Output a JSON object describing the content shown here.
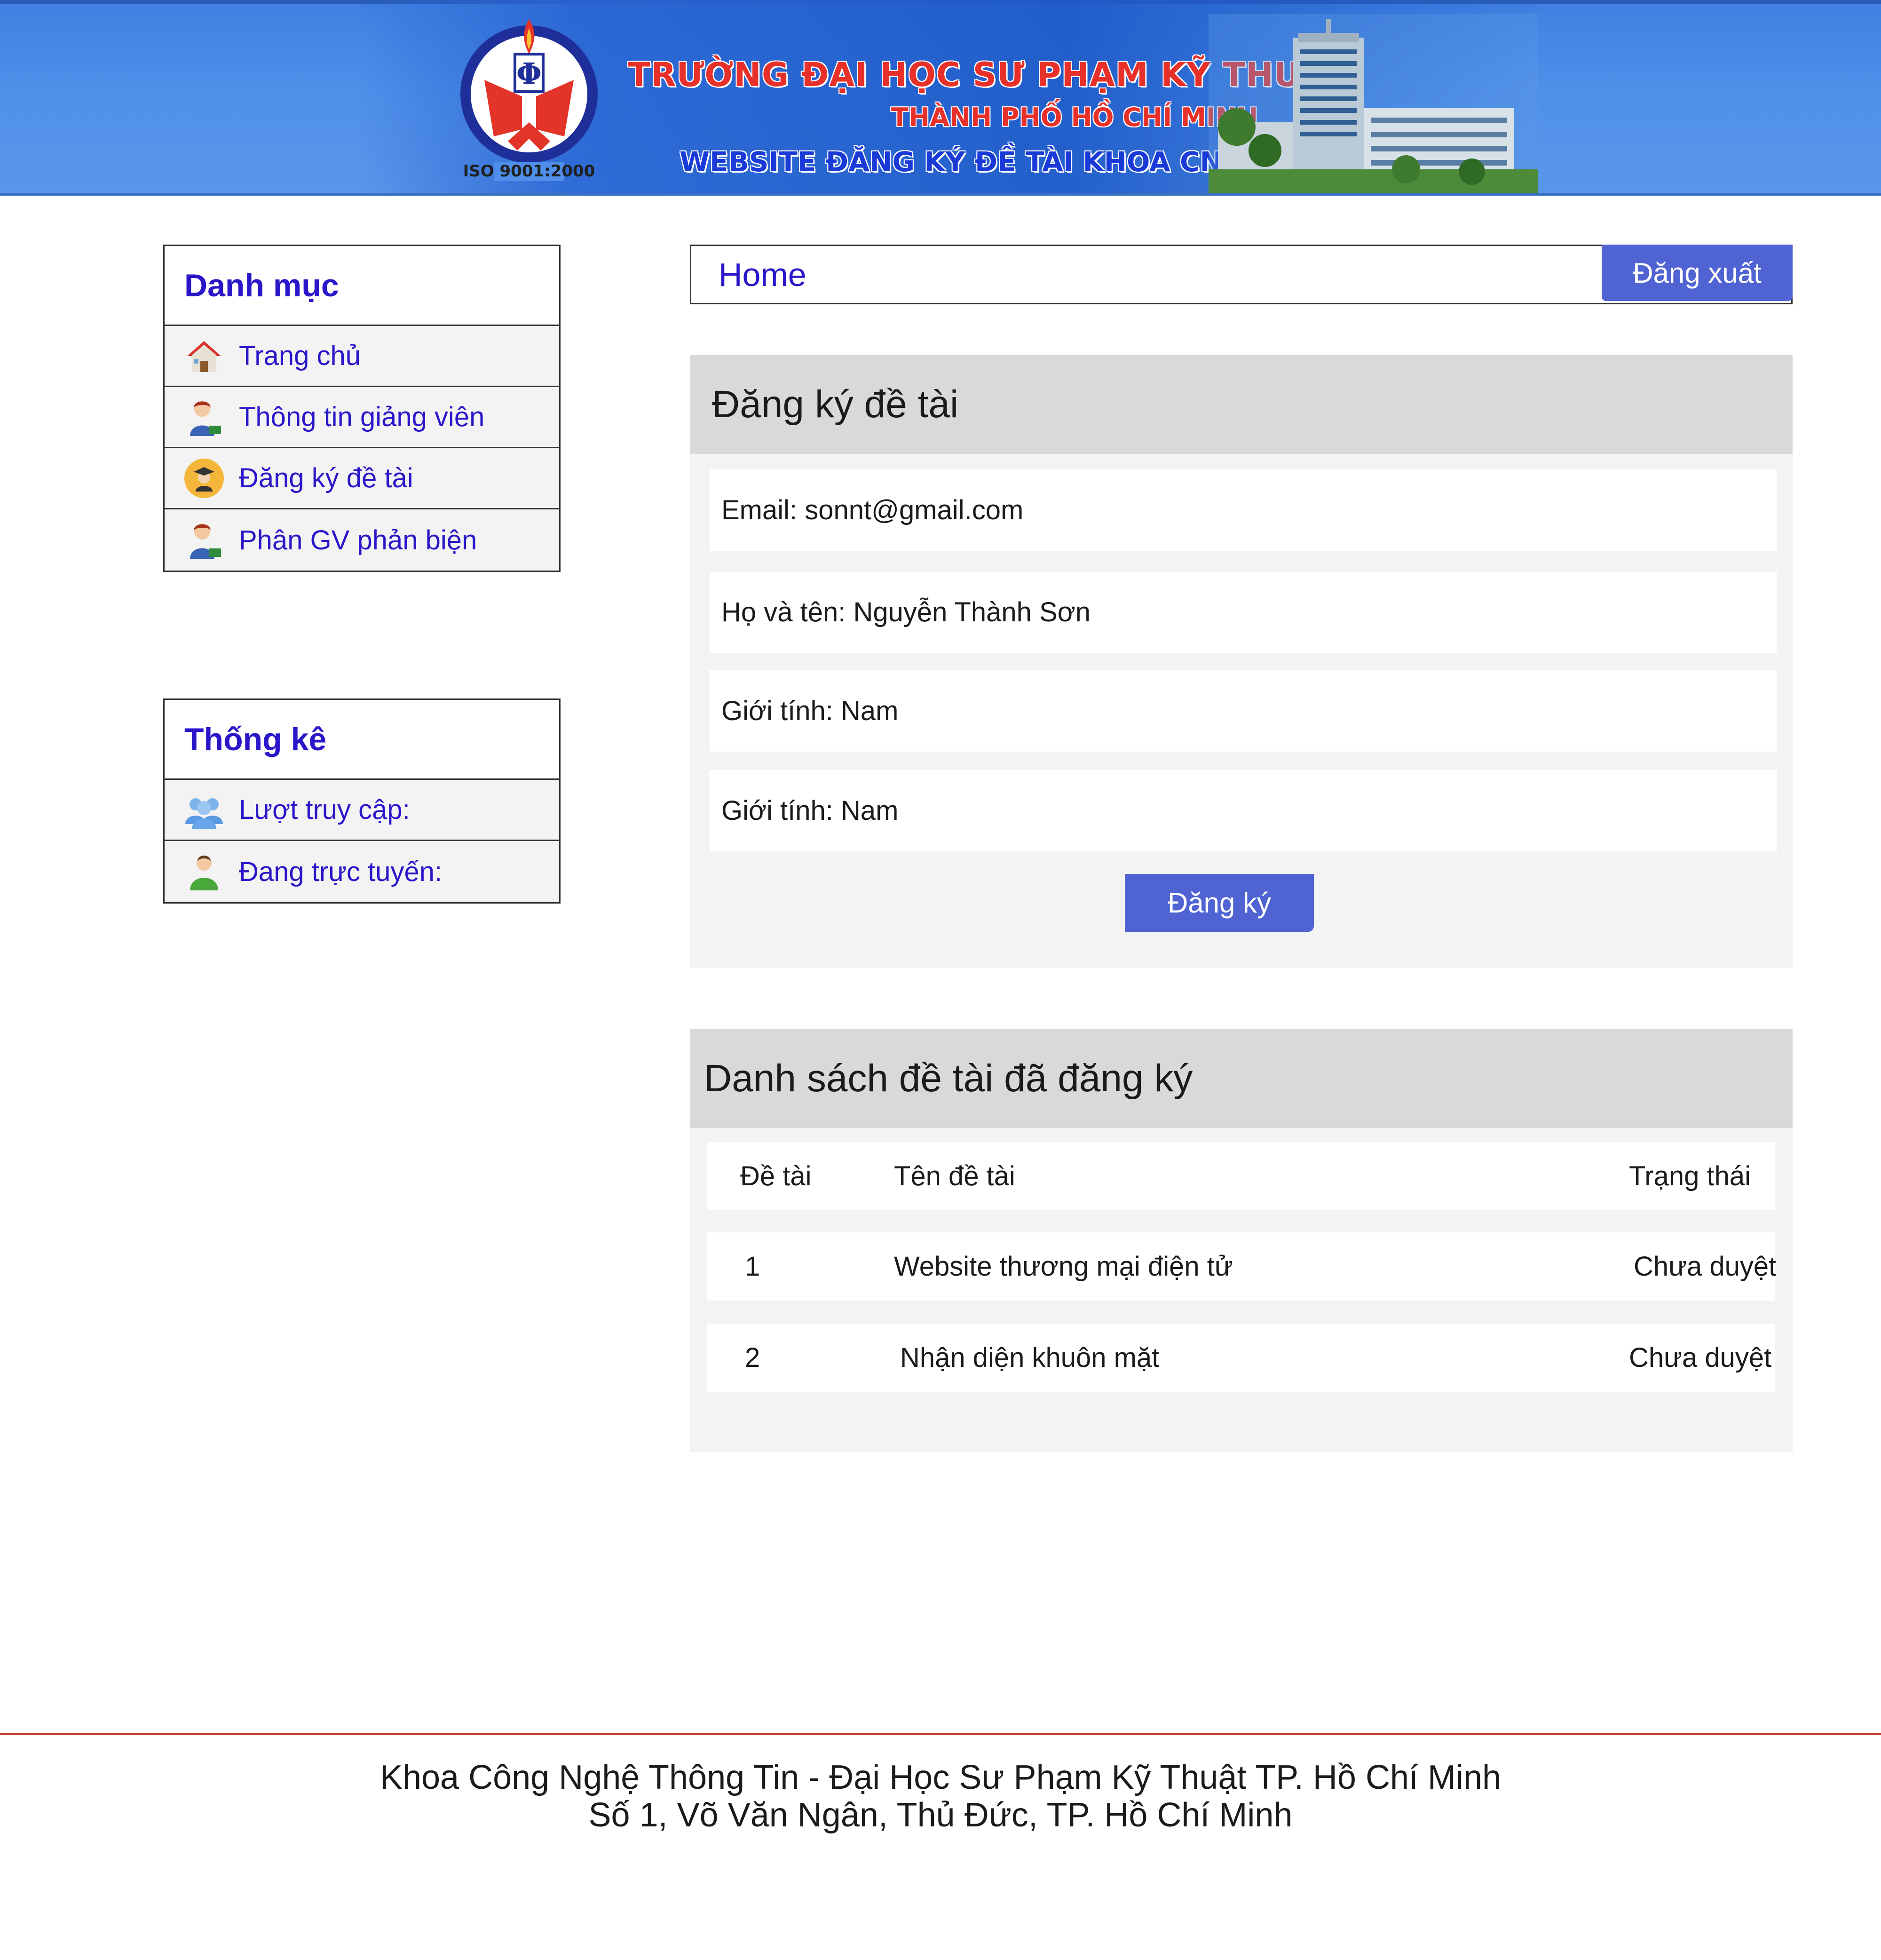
{
  "banner": {
    "line1": "TRƯỜNG ĐẠI HỌC SƯ PHẠM KỸ THUẬT",
    "line2": "THÀNH PHỐ HỒ CHÍ MINH",
    "line3": "WEBSITE ĐĂNG KÝ ĐỀ TÀI KHOA CNTT",
    "logo_text": "ISO 9001:2000",
    "logo_icon": "university-logo-icon"
  },
  "sidebar": {
    "menu_title": "Danh mục",
    "menu_items": [
      {
        "label": "Trang chủ",
        "icon": "home-icon"
      },
      {
        "label": "Thông tin giảng viên",
        "icon": "teacher-icon"
      },
      {
        "label": "Đăng ký đề tài",
        "icon": "graduate-icon"
      },
      {
        "label": "Phân GV phản biện",
        "icon": "teacher-icon"
      }
    ],
    "stats_title": "Thống kê",
    "stats_items": [
      {
        "label": "Lượt truy cập:",
        "icon": "users-icon"
      },
      {
        "label": "Đang trực tuyến:",
        "icon": "online-user-icon"
      }
    ]
  },
  "topbar": {
    "home_label": "Home",
    "logout_label": "Đăng xuất"
  },
  "register": {
    "title": "Đăng ký đề tài",
    "fields": [
      "Email: sonnt@gmail.com",
      "Họ và tên: Nguyễn Thành Sơn",
      "Giới tính: Nam",
      "Giới tính: Nam"
    ],
    "submit_label": "Đăng ký"
  },
  "topics": {
    "title": "Danh sách đề tài đã đăng ký",
    "columns": [
      "Đề tài",
      "Tên đề tài",
      "Trạng thái"
    ],
    "rows": [
      [
        "1",
        "Website thương mại điện tử",
        "Chưa duyệt"
      ],
      [
        "2",
        "Nhận diện khuôn mặt",
        "Chưa duyệt"
      ]
    ]
  },
  "footer": {
    "line1": "Khoa Công Nghệ Thông Tin - Đại Học Sư Phạm Kỹ Thuật TP. Hồ Chí Minh",
    "line2": "Số 1, Võ Văn Ngân, Thủ Đức, TP. Hồ Chí Minh"
  },
  "colors": {
    "accent": "#4f63d2",
    "link": "#2a16c9",
    "card_head": "#d9d9d9",
    "card_bg": "#f3f3f3",
    "footer_line": "#c0392b"
  }
}
